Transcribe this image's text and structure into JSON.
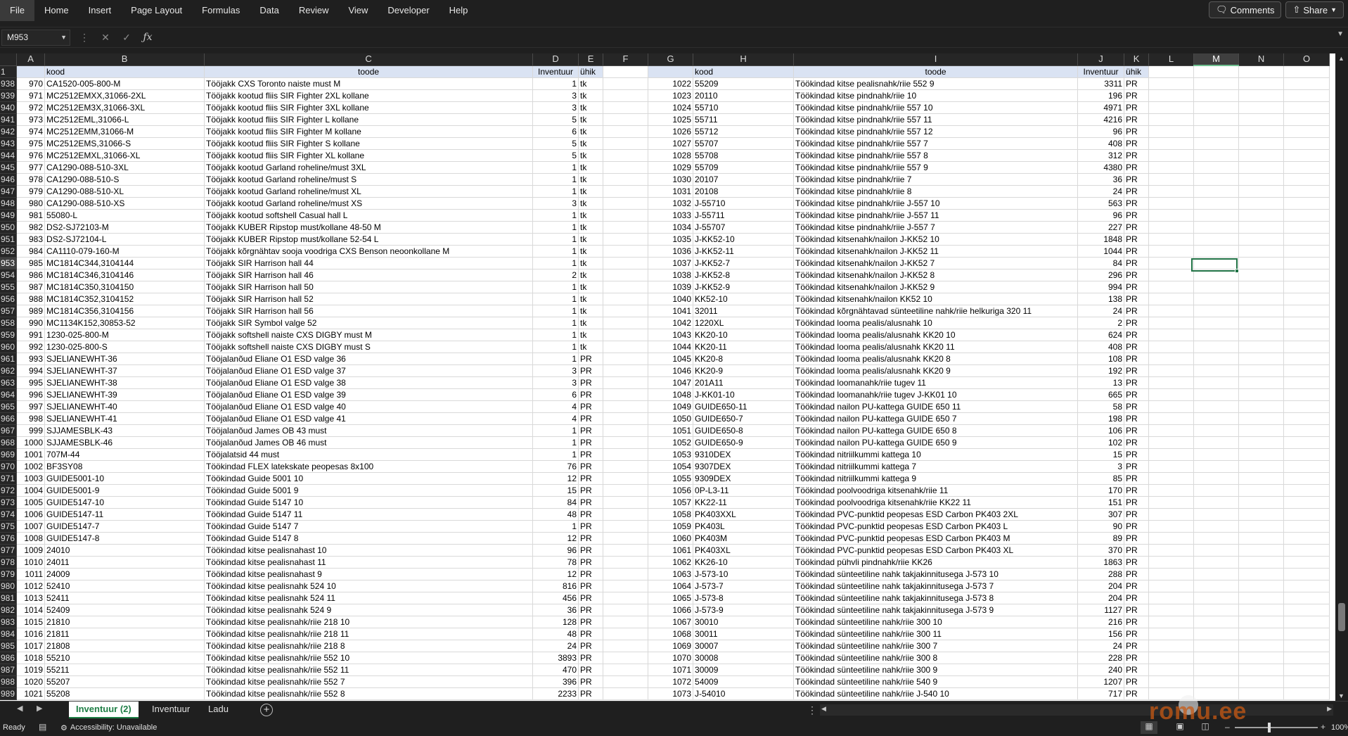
{
  "menu": [
    "File",
    "Home",
    "Insert",
    "Page Layout",
    "Formulas",
    "Data",
    "Review",
    "View",
    "Developer",
    "Help"
  ],
  "top_buttons": {
    "comments": "Comments",
    "share": "Share"
  },
  "formula_bar": {
    "name_box": "M953",
    "formula": ""
  },
  "columns": [
    "A",
    "B",
    "C",
    "D",
    "E",
    "F",
    "G",
    "H",
    "I",
    "J",
    "K",
    "L",
    "M",
    "N",
    "O"
  ],
  "selected_column": "M",
  "selected_row": "953",
  "header_row": {
    "row_num": "1",
    "kood": "kood",
    "toode": "toode",
    "inventuur": "Inventuur",
    "uhik": "ühik",
    "kood2": "kood",
    "toode2": "toode",
    "inventuur2": "Inventuur",
    "uhik2": "ühik"
  },
  "rows": [
    {
      "r": "938",
      "a": "970",
      "b": "CA1520-005-800-M",
      "c": "Tööjakk CXS Toronto naiste must M",
      "d": "1",
      "e": "tk",
      "g": "1022",
      "h": "55209",
      "i": "Töökindad kitse pealisnahk/riie 552 9",
      "j": "3311",
      "k": "PR"
    },
    {
      "r": "939",
      "a": "971",
      "b": "MC2512EMXX,31066-2XL",
      "c": "Tööjakk kootud fliis SIR Fighter 2XL kollane",
      "d": "3",
      "e": "tk",
      "g": "1023",
      "h": "20110",
      "i": "Töökindad kitse pindnahk/riie 10",
      "j": "196",
      "k": "PR"
    },
    {
      "r": "940",
      "a": "972",
      "b": "MC2512EM3X,31066-3XL",
      "c": "Tööjakk kootud fliis SIR Fighter 3XL kollane",
      "d": "3",
      "e": "tk",
      "g": "1024",
      "h": "55710",
      "i": "Töökindad kitse pindnahk/riie 557 10",
      "j": "4971",
      "k": "PR"
    },
    {
      "r": "941",
      "a": "973",
      "b": "MC2512EML,31066-L",
      "c": "Tööjakk kootud fliis SIR Fighter L kollane",
      "d": "5",
      "e": "tk",
      "g": "1025",
      "h": "55711",
      "i": "Töökindad kitse pindnahk/riie 557 11",
      "j": "4216",
      "k": "PR"
    },
    {
      "r": "942",
      "a": "974",
      "b": "MC2512EMM,31066-M",
      "c": "Tööjakk kootud fliis SIR Fighter M kollane",
      "d": "6",
      "e": "tk",
      "g": "1026",
      "h": "55712",
      "i": "Töökindad kitse pindnahk/riie 557 12",
      "j": "96",
      "k": "PR"
    },
    {
      "r": "943",
      "a": "975",
      "b": "MC2512EMS,31066-S",
      "c": "Tööjakk kootud fliis SIR Fighter S kollane",
      "d": "5",
      "e": "tk",
      "g": "1027",
      "h": "55707",
      "i": "Töökindad kitse pindnahk/riie 557 7",
      "j": "408",
      "k": "PR"
    },
    {
      "r": "944",
      "a": "976",
      "b": "MC2512EMXL,31066-XL",
      "c": "Tööjakk kootud fliis SIR Fighter XL kollane",
      "d": "5",
      "e": "tk",
      "g": "1028",
      "h": "55708",
      "i": "Töökindad kitse pindnahk/riie 557 8",
      "j": "312",
      "k": "PR"
    },
    {
      "r": "945",
      "a": "977",
      "b": "CA1290-088-510-3XL",
      "c": "Tööjakk kootud Garland roheline/must 3XL",
      "d": "1",
      "e": "tk",
      "g": "1029",
      "h": "55709",
      "i": "Töökindad kitse pindnahk/riie 557 9",
      "j": "4380",
      "k": "PR"
    },
    {
      "r": "946",
      "a": "978",
      "b": "CA1290-088-510-S",
      "c": "Tööjakk kootud Garland roheline/must S",
      "d": "1",
      "e": "tk",
      "g": "1030",
      "h": "20107",
      "i": "Töökindad kitse pindnahk/riie 7",
      "j": "36",
      "k": "PR"
    },
    {
      "r": "947",
      "a": "979",
      "b": "CA1290-088-510-XL",
      "c": "Tööjakk kootud Garland roheline/must XL",
      "d": "1",
      "e": "tk",
      "g": "1031",
      "h": "20108",
      "i": "Töökindad kitse pindnahk/riie 8",
      "j": "24",
      "k": "PR"
    },
    {
      "r": "948",
      "a": "980",
      "b": "CA1290-088-510-XS",
      "c": "Tööjakk kootud Garland roheline/must XS",
      "d": "3",
      "e": "tk",
      "g": "1032",
      "h": "J-55710",
      "i": "Töökindad kitse pindnahk/riie J-557 10",
      "j": "563",
      "k": "PR"
    },
    {
      "r": "949",
      "a": "981",
      "b": "55080-L",
      "c": "Tööjakk kootud softshell Casual hall L",
      "d": "1",
      "e": "tk",
      "g": "1033",
      "h": "J-55711",
      "i": "Töökindad kitse pindnahk/riie J-557 11",
      "j": "96",
      "k": "PR"
    },
    {
      "r": "950",
      "a": "982",
      "b": "DS2-SJ72103-M",
      "c": "Tööjakk KUBER Ripstop must/kollane 48-50 M",
      "d": "1",
      "e": "tk",
      "g": "1034",
      "h": "J-55707",
      "i": "Töökindad kitse pindnahk/riie J-557 7",
      "j": "227",
      "k": "PR"
    },
    {
      "r": "951",
      "a": "983",
      "b": "DS2-SJ72104-L",
      "c": "Tööjakk KUBER Ripstop must/kollane 52-54 L",
      "d": "1",
      "e": "tk",
      "g": "1035",
      "h": "J-KK52-10",
      "i": "Töökindad kitsenahk/nailon J-KK52 10",
      "j": "1848",
      "k": "PR"
    },
    {
      "r": "952",
      "a": "984",
      "b": "CA1110-079-160-M",
      "c": "Tööjakk kõrgnähtav sooja voodriga CXS Benson neoonkollane M",
      "d": "1",
      "e": "tk",
      "g": "1036",
      "h": "J-KK52-11",
      "i": "Töökindad kitsenahk/nailon J-KK52 11",
      "j": "1044",
      "k": "PR"
    },
    {
      "r": "953",
      "a": "985",
      "b": "MC1814C344,3104144",
      "c": "Tööjakk SIR Harrison hall 44",
      "d": "1",
      "e": "tk",
      "g": "1037",
      "h": "J-KK52-7",
      "i": "Töökindad kitsenahk/nailon J-KK52 7",
      "j": "84",
      "k": "PR"
    },
    {
      "r": "954",
      "a": "986",
      "b": "MC1814C346,3104146",
      "c": "Tööjakk SIR Harrison hall 46",
      "d": "2",
      "e": "tk",
      "g": "1038",
      "h": "J-KK52-8",
      "i": "Töökindad kitsenahk/nailon J-KK52 8",
      "j": "296",
      "k": "PR"
    },
    {
      "r": "955",
      "a": "987",
      "b": "MC1814C350,3104150",
      "c": "Tööjakk SIR Harrison hall 50",
      "d": "1",
      "e": "tk",
      "g": "1039",
      "h": "J-KK52-9",
      "i": "Töökindad kitsenahk/nailon J-KK52 9",
      "j": "994",
      "k": "PR"
    },
    {
      "r": "956",
      "a": "988",
      "b": "MC1814C352,3104152",
      "c": "Tööjakk SIR Harrison hall 52",
      "d": "1",
      "e": "tk",
      "g": "1040",
      "h": "KK52-10",
      "i": "Töökindad kitsenahk/nailon KK52 10",
      "j": "138",
      "k": "PR"
    },
    {
      "r": "957",
      "a": "989",
      "b": "MC1814C356,3104156",
      "c": "Tööjakk SIR Harrison hall 56",
      "d": "1",
      "e": "tk",
      "g": "1041",
      "h": "32011",
      "i": "Töökindad kõrgnähtavad sünteetiline nahk/riie helkuriga 320 11",
      "j": "24",
      "k": "PR"
    },
    {
      "r": "958",
      "a": "990",
      "b": "MC1134K152,30853-52",
      "c": "Tööjakk SIR Symbol valge 52",
      "d": "1",
      "e": "tk",
      "g": "1042",
      "h": "1220XL",
      "i": "Töökindad looma pealis/alusnahk 10",
      "j": "2",
      "k": "PR"
    },
    {
      "r": "959",
      "a": "991",
      "b": "1230-025-800-M",
      "c": "Tööjakk softshell naiste CXS DIGBY must M",
      "d": "1",
      "e": "tk",
      "g": "1043",
      "h": "KK20-10",
      "i": "Töökindad looma pealis/alusnahk KK20 10",
      "j": "624",
      "k": "PR"
    },
    {
      "r": "960",
      "a": "992",
      "b": "1230-025-800-S",
      "c": "Tööjakk softshell naiste CXS DIGBY must S",
      "d": "1",
      "e": "tk",
      "g": "1044",
      "h": "KK20-11",
      "i": "Töökindad looma pealis/alusnahk KK20 11",
      "j": "408",
      "k": "PR"
    },
    {
      "r": "961",
      "a": "993",
      "b": "SJELIANEWHT-36",
      "c": "Tööjalanõud Eliane O1 ESD valge 36",
      "d": "1",
      "e": "PR",
      "g": "1045",
      "h": "KK20-8",
      "i": "Töökindad looma pealis/alusnahk KK20 8",
      "j": "108",
      "k": "PR"
    },
    {
      "r": "962",
      "a": "994",
      "b": "SJELIANEWHT-37",
      "c": "Tööjalanõud Eliane O1 ESD valge 37",
      "d": "3",
      "e": "PR",
      "g": "1046",
      "h": "KK20-9",
      "i": "Töökindad looma pealis/alusnahk KK20 9",
      "j": "192",
      "k": "PR"
    },
    {
      "r": "963",
      "a": "995",
      "b": "SJELIANEWHT-38",
      "c": "Tööjalanõud Eliane O1 ESD valge 38",
      "d": "3",
      "e": "PR",
      "g": "1047",
      "h": "201A11",
      "i": "Töökindad loomanahk/riie tugev 11",
      "j": "13",
      "k": "PR"
    },
    {
      "r": "964",
      "a": "996",
      "b": "SJELIANEWHT-39",
      "c": "Tööjalanõud Eliane O1 ESD valge 39",
      "d": "6",
      "e": "PR",
      "g": "1048",
      "h": "J-KK01-10",
      "i": "Töökindad loomanahk/riie tugev J-KK01 10",
      "j": "665",
      "k": "PR"
    },
    {
      "r": "965",
      "a": "997",
      "b": "SJELIANEWHT-40",
      "c": "Tööjalanõud Eliane O1 ESD valge 40",
      "d": "4",
      "e": "PR",
      "g": "1049",
      "h": "GUIDE650-11",
      "i": "Töökindad nailon PU-kattega GUIDE 650 11",
      "j": "58",
      "k": "PR"
    },
    {
      "r": "966",
      "a": "998",
      "b": "SJELIANEWHT-41",
      "c": "Tööjalanõud Eliane O1 ESD valge 41",
      "d": "4",
      "e": "PR",
      "g": "1050",
      "h": "GUIDE650-7",
      "i": "Töökindad nailon PU-kattega GUIDE 650 7",
      "j": "198",
      "k": "PR"
    },
    {
      "r": "967",
      "a": "999",
      "b": "SJJAMESBLK-43",
      "c": "Tööjalanõud James OB 43 must",
      "d": "1",
      "e": "PR",
      "g": "1051",
      "h": "GUIDE650-8",
      "i": "Töökindad nailon PU-kattega GUIDE 650 8",
      "j": "106",
      "k": "PR"
    },
    {
      "r": "968",
      "a": "1000",
      "b": "SJJAMESBLK-46",
      "c": "Tööjalanõud James OB 46 must",
      "d": "1",
      "e": "PR",
      "g": "1052",
      "h": "GUIDE650-9",
      "i": "Töökindad nailon PU-kattega GUIDE 650 9",
      "j": "102",
      "k": "PR"
    },
    {
      "r": "969",
      "a": "1001",
      "b": "707M-44",
      "c": "Tööjalatsid 44 must",
      "d": "1",
      "e": "PR",
      "g": "1053",
      "h": "9310DEX",
      "i": "Töökindad nitriilkummi kattega 10",
      "j": "15",
      "k": "PR"
    },
    {
      "r": "970",
      "a": "1002",
      "b": "BF3SY08",
      "c": "Töökindad FLEX latekskate peopesas 8x100",
      "d": "76",
      "e": "PR",
      "g": "1054",
      "h": "9307DEX",
      "i": "Töökindad nitriilkummi kattega 7",
      "j": "3",
      "k": "PR"
    },
    {
      "r": "971",
      "a": "1003",
      "b": "GUIDE5001-10",
      "c": "Töökindad Guide 5001 10",
      "d": "12",
      "e": "PR",
      "g": "1055",
      "h": "9309DEX",
      "i": "Töökindad nitriilkummi kattega 9",
      "j": "85",
      "k": "PR"
    },
    {
      "r": "972",
      "a": "1004",
      "b": "GUIDE5001-9",
      "c": "Töökindad Guide 5001 9",
      "d": "15",
      "e": "PR",
      "g": "1056",
      "h": "0P-L3-11",
      "i": "Töökindad poolvoodriga kitsenahk/riie 11",
      "j": "170",
      "k": "PR"
    },
    {
      "r": "973",
      "a": "1005",
      "b": "GUIDE5147-10",
      "c": "Töökindad Guide 5147 10",
      "d": "84",
      "e": "PR",
      "g": "1057",
      "h": "KK22-11",
      "i": "Töökindad poolvoodriga kitsenahk/riie KK22 11",
      "j": "151",
      "k": "PR"
    },
    {
      "r": "974",
      "a": "1006",
      "b": "GUIDE5147-11",
      "c": "Töökindad Guide 5147 11",
      "d": "48",
      "e": "PR",
      "g": "1058",
      "h": "PK403XXL",
      "i": "Töökindad PVC-punktid peopesas ESD Carbon PK403 2XL",
      "j": "307",
      "k": "PR"
    },
    {
      "r": "975",
      "a": "1007",
      "b": "GUIDE5147-7",
      "c": "Töökindad Guide 5147 7",
      "d": "1",
      "e": "PR",
      "g": "1059",
      "h": "PK403L",
      "i": "Töökindad PVC-punktid peopesas ESD Carbon PK403 L",
      "j": "90",
      "k": "PR"
    },
    {
      "r": "976",
      "a": "1008",
      "b": "GUIDE5147-8",
      "c": "Töökindad Guide 5147 8",
      "d": "12",
      "e": "PR",
      "g": "1060",
      "h": "PK403M",
      "i": "Töökindad PVC-punktid peopesas ESD Carbon PK403 M",
      "j": "89",
      "k": "PR"
    },
    {
      "r": "977",
      "a": "1009",
      "b": "24010",
      "c": "Töökindad kitse pealisnahast 10",
      "d": "96",
      "e": "PR",
      "g": "1061",
      "h": "PK403XL",
      "i": "Töökindad PVC-punktid peopesas ESD Carbon PK403 XL",
      "j": "370",
      "k": "PR"
    },
    {
      "r": "978",
      "a": "1010",
      "b": "24011",
      "c": "Töökindad kitse pealisnahast 11",
      "d": "78",
      "e": "PR",
      "g": "1062",
      "h": "KK26-10",
      "i": "Töökindad pühvli pindnahk/riie KK26",
      "j": "1863",
      "k": "PR"
    },
    {
      "r": "979",
      "a": "1011",
      "b": "24009",
      "c": "Töökindad kitse pealisnahast 9",
      "d": "12",
      "e": "PR",
      "g": "1063",
      "h": "J-573-10",
      "i": "Töökindad sünteetiline nahk takjakinnitusega J-573 10",
      "j": "288",
      "k": "PR"
    },
    {
      "r": "980",
      "a": "1012",
      "b": "52410",
      "c": "Töökindad kitse pealisnahk 524 10",
      "d": "816",
      "e": "PR",
      "g": "1064",
      "h": "J-573-7",
      "i": "Töökindad sünteetiline nahk takjakinnitusega J-573 7",
      "j": "204",
      "k": "PR"
    },
    {
      "r": "981",
      "a": "1013",
      "b": "52411",
      "c": "Töökindad kitse pealisnahk 524 11",
      "d": "456",
      "e": "PR",
      "g": "1065",
      "h": "J-573-8",
      "i": "Töökindad sünteetiline nahk takjakinnitusega J-573 8",
      "j": "204",
      "k": "PR"
    },
    {
      "r": "982",
      "a": "1014",
      "b": "52409",
      "c": "Töökindad kitse pealisnahk 524 9",
      "d": "36",
      "e": "PR",
      "g": "1066",
      "h": "J-573-9",
      "i": "Töökindad sünteetiline nahk takjakinnitusega J-573 9",
      "j": "1127",
      "k": "PR"
    },
    {
      "r": "983",
      "a": "1015",
      "b": "21810",
      "c": "Töökindad kitse pealisnahk/riie 218 10",
      "d": "128",
      "e": "PR",
      "g": "1067",
      "h": "30010",
      "i": "Töökindad sünteetiline nahk/riie 300 10",
      "j": "216",
      "k": "PR"
    },
    {
      "r": "984",
      "a": "1016",
      "b": "21811",
      "c": "Töökindad kitse pealisnahk/riie 218 11",
      "d": "48",
      "e": "PR",
      "g": "1068",
      "h": "30011",
      "i": "Töökindad sünteetiline nahk/riie 300 11",
      "j": "156",
      "k": "PR"
    },
    {
      "r": "985",
      "a": "1017",
      "b": "21808",
      "c": "Töökindad kitse pealisnahk/riie 218 8",
      "d": "24",
      "e": "PR",
      "g": "1069",
      "h": "30007",
      "i": "Töökindad sünteetiline nahk/riie 300 7",
      "j": "24",
      "k": "PR"
    },
    {
      "r": "986",
      "a": "1018",
      "b": "55210",
      "c": "Töökindad kitse pealisnahk/riie 552 10",
      "d": "3893",
      "e": "PR",
      "g": "1070",
      "h": "30008",
      "i": "Töökindad sünteetiline nahk/riie 300 8",
      "j": "228",
      "k": "PR"
    },
    {
      "r": "987",
      "a": "1019",
      "b": "55211",
      "c": "Töökindad kitse pealisnahk/riie 552 11",
      "d": "470",
      "e": "PR",
      "g": "1071",
      "h": "30009",
      "i": "Töökindad sünteetiline nahk/riie 300 9",
      "j": "240",
      "k": "PR"
    },
    {
      "r": "988",
      "a": "1020",
      "b": "55207",
      "c": "Töökindad kitse pealisnahk/riie 552 7",
      "d": "396",
      "e": "PR",
      "g": "1072",
      "h": "54009",
      "i": "Töökindad sünteetiline nahk/riie 540 9",
      "j": "1207",
      "k": "PR"
    },
    {
      "r": "989",
      "a": "1021",
      "b": "55208",
      "c": "Töökindad kitse pealisnahk/riie 552 8",
      "d": "2233",
      "e": "PR",
      "g": "1073",
      "h": "J-54010",
      "i": "Töökindad sünteetiline nahk/riie J-540 10",
      "j": "717",
      "k": "PR"
    }
  ],
  "sheets": [
    {
      "label": "Inventuur (2)",
      "active": true
    },
    {
      "label": "Inventuur",
      "active": false
    },
    {
      "label": "Ladu",
      "active": false
    }
  ],
  "status": {
    "ready": "Ready",
    "accessibility": "Accessibility: Unavailable",
    "zoom": "100%"
  },
  "watermark": "romu.ee",
  "colors": {
    "header_fill": "#dae3f3",
    "selection": "#217346",
    "sheet_tab_accent": "#1e7e45"
  }
}
